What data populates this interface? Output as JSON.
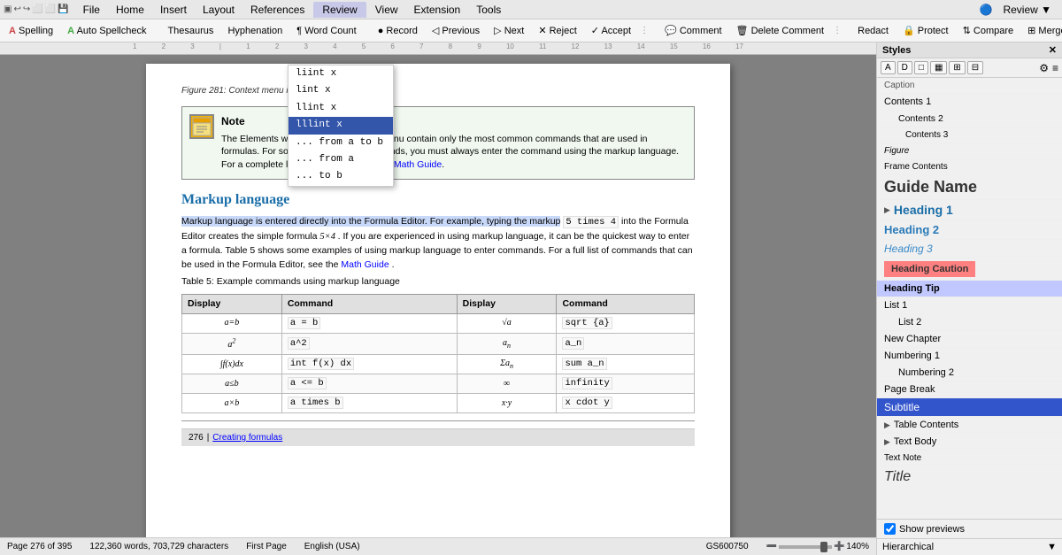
{
  "menubar": {
    "icons": [
      "▣",
      "↩",
      "↪",
      "⬜",
      "⬜",
      "⬜",
      "💾"
    ],
    "items": [
      "File",
      "Home",
      "Insert",
      "Layout",
      "References",
      "Review",
      "View",
      "Extension",
      "Tools"
    ]
  },
  "toolbar_review": {
    "items": [
      {
        "label": "Spelling",
        "icon": "A"
      },
      {
        "label": "Auto Spellcheck",
        "icon": "A"
      },
      {
        "label": "Thesaurus"
      },
      {
        "label": "Hyphenation"
      },
      {
        "label": "Word Count",
        "icon": "¶"
      },
      {
        "label": "Record",
        "icon": "●"
      },
      {
        "label": "Previous",
        "icon": "◁"
      },
      {
        "label": "Next",
        "icon": "▷"
      },
      {
        "label": "Reject",
        "icon": "✕"
      },
      {
        "label": "Accept",
        "icon": "✓"
      },
      {
        "label": "Comment"
      },
      {
        "label": "Delete Comment"
      },
      {
        "label": "Redact"
      },
      {
        "label": "Protect"
      },
      {
        "label": "Compare"
      },
      {
        "label": "Merge"
      }
    ],
    "review_label": "Review ▼"
  },
  "autocomplete": {
    "items": [
      {
        "text": "liint x"
      },
      {
        "text": "lint x"
      },
      {
        "text": "llint x"
      },
      {
        "text": "lllint x",
        "selected": true
      },
      {
        "text": "... from a to b"
      },
      {
        "text": "... from a"
      },
      {
        "text": "... to b"
      }
    ]
  },
  "figure_caption": "Figure 281: Context menu in Formula Editor",
  "note": {
    "title": "Note",
    "text": "The Elements window and the context menu contain only the most common commands that are used in formulas. For some seldom-used commands, you must always enter the command using the markup language. For a complete list of commands, see the ",
    "link": "Math Guide",
    "text_after": "."
  },
  "section": {
    "heading": "Markup language",
    "body1": "Markup language is entered directly into the Formula Editor. For example, typing the markup",
    "code1": "5 times 4",
    "body2": "into the Formula Editor creates the simple formula",
    "formula1": "5×4",
    "body3": ". If you are experienced in using markup language, it can be the quickest way to enter a formula. Table 5 shows some examples of using markup language to enter commands. For a full list of commands that can be used in the Formula Editor, see the",
    "link": "Math Guide",
    "body4": "."
  },
  "table": {
    "caption": "Table 5: Example commands using markup language",
    "headers": [
      "Display",
      "Command",
      "Display",
      "Command"
    ],
    "rows": [
      {
        "d1": "a=b",
        "c1": "a = b",
        "d2": "√a",
        "c2": "sqrt {a}"
      },
      {
        "d1": "a²",
        "c1": "a^2",
        "d2": "aₙ",
        "c2": "a_n"
      },
      {
        "d1": "∫f(x)dx",
        "c1": "int f(x) dx",
        "d2": "Σaₙ",
        "c2": "sum a_n"
      },
      {
        "d1": "a≤b",
        "c1": "a <= b",
        "d2": "∞",
        "c2": "infinity"
      },
      {
        "d1": "a×b",
        "c1": "a times b",
        "d2": "x·y",
        "c2": "x cdot y"
      }
    ]
  },
  "page_bottom": {
    "page_num": "276",
    "link": "Creating formulas"
  },
  "styles_panel": {
    "title": "Styles",
    "toolbar_buttons": [
      "A",
      "D",
      "□",
      "▦",
      "⊞",
      "⊟"
    ],
    "right_icons": [
      "⚙",
      "≡"
    ],
    "items": [
      {
        "name": "Caption",
        "style": "caption",
        "expandable": false
      },
      {
        "name": "Contents 1",
        "style": "contents1",
        "expandable": false
      },
      {
        "name": "Contents 2",
        "style": "contents2",
        "expandable": false
      },
      {
        "name": "Contents 3",
        "style": "contents3",
        "expandable": false
      },
      {
        "name": "Figure",
        "style": "figure",
        "expandable": false
      },
      {
        "name": "Frame Contents",
        "style": "framecontents",
        "expandable": false
      },
      {
        "name": "Guide Name",
        "style": "guidename",
        "expandable": false
      },
      {
        "name": "Heading 1",
        "style": "heading1",
        "expandable": true
      },
      {
        "name": "Heading 2",
        "style": "heading2",
        "expandable": false
      },
      {
        "name": "Heading 3",
        "style": "heading3",
        "expandable": false
      },
      {
        "name": "Heading Caution",
        "style": "headingcaution",
        "expandable": false
      },
      {
        "name": "Heading Tip",
        "style": "headingtip",
        "expandable": false,
        "active": true
      },
      {
        "name": "List 1",
        "style": "list1",
        "expandable": false
      },
      {
        "name": "List 2",
        "style": "list2",
        "expandable": false
      },
      {
        "name": "New Chapter",
        "style": "newchapter",
        "expandable": false
      },
      {
        "name": "Numbering 1",
        "style": "numbering1",
        "expandable": false
      },
      {
        "name": "Numbering 2",
        "style": "numbering2",
        "expandable": false
      },
      {
        "name": "Page Break",
        "style": "pagebreak",
        "expandable": false
      },
      {
        "name": "Subtitle",
        "style": "subtitle",
        "expandable": false,
        "active_blue": true
      },
      {
        "name": "Table Contents",
        "style": "tablecontents",
        "expandable": true
      },
      {
        "name": "Text Body",
        "style": "textbody",
        "expandable": true
      },
      {
        "name": "Text Note",
        "style": "textnote",
        "expandable": false
      },
      {
        "name": "Title",
        "style": "title",
        "expandable": false
      }
    ],
    "footer": {
      "show_previews": "Show previews",
      "dropdown": "Hierarchical"
    }
  },
  "status_bar": {
    "page_info": "Page 276 of 395",
    "words": "122,360 words, 703,729 characters",
    "first_page": "First Page",
    "language": "English (USA)",
    "zoom": "140%",
    "extra": "GS600750"
  }
}
